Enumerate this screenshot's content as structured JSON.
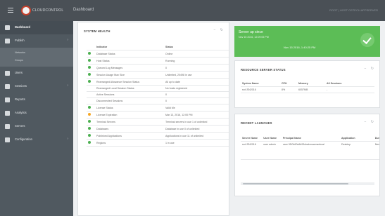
{
  "header": {
    "brand": "CLOUDCONTROL",
    "title": "Dashboard",
    "right_text": "ROOT | HOST OSTECH APPSERVER"
  },
  "sidebar": {
    "items": [
      {
        "label": "Dashboard",
        "icon": "dashboard-icon",
        "active": true
      },
      {
        "label": "Publish",
        "icon": "publish-icon",
        "has_children": true
      },
      {
        "label": "Users",
        "icon": "users-icon"
      },
      {
        "label": "Sessions",
        "icon": "sessions-icon",
        "has_children": true
      },
      {
        "label": "Reports",
        "icon": "reports-icon"
      },
      {
        "label": "Analytics",
        "icon": "analytics-icon"
      },
      {
        "label": "Servers",
        "icon": "servers-icon"
      },
      {
        "label": "Configuration",
        "icon": "configuration-icon",
        "has_children": true
      }
    ],
    "publish_sub": [
      "Networks",
      "Groups"
    ]
  },
  "system_health": {
    "title": "SYSTEM HEALTH",
    "columns": [
      "Indicator",
      "Status"
    ],
    "rows": [
      {
        "status": "green",
        "indicator": "Database Status",
        "value": "Online"
      },
      {
        "status": "green",
        "indicator": "Host Status",
        "value": "Running"
      },
      {
        "status": "green",
        "indicator": "Queued Log Messages",
        "value": "0"
      },
      {
        "status": "green",
        "indicator": "Session Usage Max Size",
        "value": "Unlimited, 20498 in use"
      },
      {
        "status": "green",
        "indicator": "Rearranged Allowance Session Status",
        "value": "All up to date"
      },
      {
        "status": "",
        "indicator": "Rearranged Local Session Status",
        "value": "No hosts registered"
      },
      {
        "status": "",
        "indicator": "Active Sessions",
        "value": "0"
      },
      {
        "status": "",
        "indicator": "Disconnected Sessions",
        "value": "0"
      },
      {
        "status": "green",
        "indicator": "License Status",
        "value": "Valid Me"
      },
      {
        "status": "orange",
        "indicator": "License Expiration",
        "value": "Mar 13, 2016, 12:00 PM"
      },
      {
        "status": "green",
        "indicator": "Terminal Servers",
        "value": "Terminal servers in use 1 of unlimited"
      },
      {
        "status": "green",
        "indicator": "Databases",
        "value": "Database in use 0 of unlimited"
      },
      {
        "status": "green",
        "indicator": "Published Applications",
        "value": "Applications in use 11 of unlimited"
      },
      {
        "status": "green",
        "indicator": "Regions",
        "value": "1 in use"
      }
    ]
  },
  "server_up": {
    "title": "Server up since",
    "subtitle": "Nov 15 2016, 12:09:05 PM",
    "center": "Nov 15 2016, 1:40:25 PM",
    "icon": "check-icon",
    "color": "#5cbd56"
  },
  "resource_status": {
    "title": "RESOURCE SERVER STATUS",
    "columns": [
      "System Name",
      "CPU",
      "Memory",
      "All Sessions"
    ],
    "rows": [
      [
        "srv1SN2016",
        "8%",
        "6057MB",
        "-"
      ]
    ]
  },
  "recent_launches": {
    "title": "RECENT LAUNCHES",
    "columns": [
      "Server Name",
      "User Name",
      "Principal Name",
      "Application",
      "Duration"
    ],
    "rows": [
      [
        "srv1SN2016",
        "user admin",
        "user 9D0b90c6b93cbakmuwmsebcal",
        "Desktop",
        "New"
      ]
    ]
  },
  "panel_tools": {
    "collapse": "−",
    "refresh": "↻"
  }
}
